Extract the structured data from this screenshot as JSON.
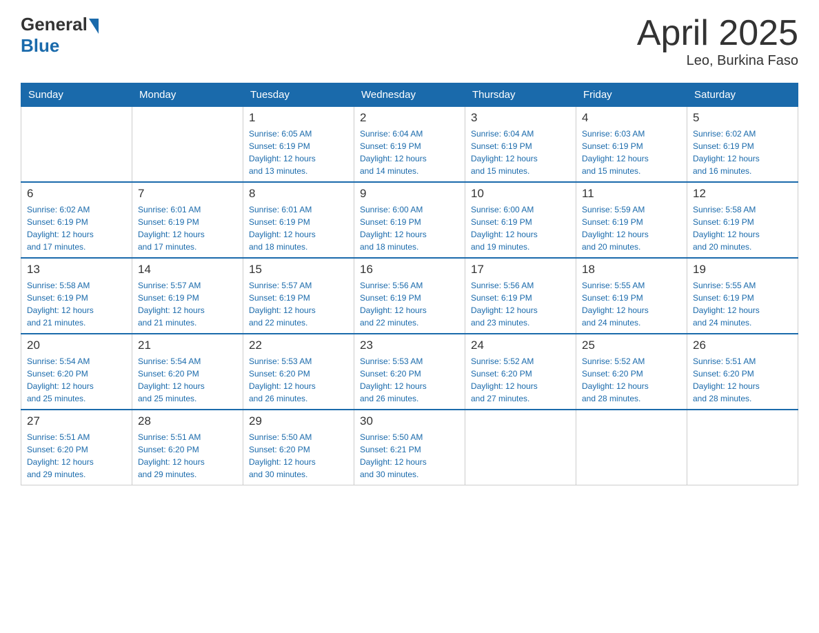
{
  "logo": {
    "text_general": "General",
    "text_blue": "Blue"
  },
  "header": {
    "title": "April 2025",
    "subtitle": "Leo, Burkina Faso"
  },
  "days_of_week": [
    "Sunday",
    "Monday",
    "Tuesday",
    "Wednesday",
    "Thursday",
    "Friday",
    "Saturday"
  ],
  "weeks": [
    [
      {
        "day": "",
        "info": ""
      },
      {
        "day": "",
        "info": ""
      },
      {
        "day": "1",
        "info": "Sunrise: 6:05 AM\nSunset: 6:19 PM\nDaylight: 12 hours\nand 13 minutes."
      },
      {
        "day": "2",
        "info": "Sunrise: 6:04 AM\nSunset: 6:19 PM\nDaylight: 12 hours\nand 14 minutes."
      },
      {
        "day": "3",
        "info": "Sunrise: 6:04 AM\nSunset: 6:19 PM\nDaylight: 12 hours\nand 15 minutes."
      },
      {
        "day": "4",
        "info": "Sunrise: 6:03 AM\nSunset: 6:19 PM\nDaylight: 12 hours\nand 15 minutes."
      },
      {
        "day": "5",
        "info": "Sunrise: 6:02 AM\nSunset: 6:19 PM\nDaylight: 12 hours\nand 16 minutes."
      }
    ],
    [
      {
        "day": "6",
        "info": "Sunrise: 6:02 AM\nSunset: 6:19 PM\nDaylight: 12 hours\nand 17 minutes."
      },
      {
        "day": "7",
        "info": "Sunrise: 6:01 AM\nSunset: 6:19 PM\nDaylight: 12 hours\nand 17 minutes."
      },
      {
        "day": "8",
        "info": "Sunrise: 6:01 AM\nSunset: 6:19 PM\nDaylight: 12 hours\nand 18 minutes."
      },
      {
        "day": "9",
        "info": "Sunrise: 6:00 AM\nSunset: 6:19 PM\nDaylight: 12 hours\nand 18 minutes."
      },
      {
        "day": "10",
        "info": "Sunrise: 6:00 AM\nSunset: 6:19 PM\nDaylight: 12 hours\nand 19 minutes."
      },
      {
        "day": "11",
        "info": "Sunrise: 5:59 AM\nSunset: 6:19 PM\nDaylight: 12 hours\nand 20 minutes."
      },
      {
        "day": "12",
        "info": "Sunrise: 5:58 AM\nSunset: 6:19 PM\nDaylight: 12 hours\nand 20 minutes."
      }
    ],
    [
      {
        "day": "13",
        "info": "Sunrise: 5:58 AM\nSunset: 6:19 PM\nDaylight: 12 hours\nand 21 minutes."
      },
      {
        "day": "14",
        "info": "Sunrise: 5:57 AM\nSunset: 6:19 PM\nDaylight: 12 hours\nand 21 minutes."
      },
      {
        "day": "15",
        "info": "Sunrise: 5:57 AM\nSunset: 6:19 PM\nDaylight: 12 hours\nand 22 minutes."
      },
      {
        "day": "16",
        "info": "Sunrise: 5:56 AM\nSunset: 6:19 PM\nDaylight: 12 hours\nand 22 minutes."
      },
      {
        "day": "17",
        "info": "Sunrise: 5:56 AM\nSunset: 6:19 PM\nDaylight: 12 hours\nand 23 minutes."
      },
      {
        "day": "18",
        "info": "Sunrise: 5:55 AM\nSunset: 6:19 PM\nDaylight: 12 hours\nand 24 minutes."
      },
      {
        "day": "19",
        "info": "Sunrise: 5:55 AM\nSunset: 6:19 PM\nDaylight: 12 hours\nand 24 minutes."
      }
    ],
    [
      {
        "day": "20",
        "info": "Sunrise: 5:54 AM\nSunset: 6:20 PM\nDaylight: 12 hours\nand 25 minutes."
      },
      {
        "day": "21",
        "info": "Sunrise: 5:54 AM\nSunset: 6:20 PM\nDaylight: 12 hours\nand 25 minutes."
      },
      {
        "day": "22",
        "info": "Sunrise: 5:53 AM\nSunset: 6:20 PM\nDaylight: 12 hours\nand 26 minutes."
      },
      {
        "day": "23",
        "info": "Sunrise: 5:53 AM\nSunset: 6:20 PM\nDaylight: 12 hours\nand 26 minutes."
      },
      {
        "day": "24",
        "info": "Sunrise: 5:52 AM\nSunset: 6:20 PM\nDaylight: 12 hours\nand 27 minutes."
      },
      {
        "day": "25",
        "info": "Sunrise: 5:52 AM\nSunset: 6:20 PM\nDaylight: 12 hours\nand 28 minutes."
      },
      {
        "day": "26",
        "info": "Sunrise: 5:51 AM\nSunset: 6:20 PM\nDaylight: 12 hours\nand 28 minutes."
      }
    ],
    [
      {
        "day": "27",
        "info": "Sunrise: 5:51 AM\nSunset: 6:20 PM\nDaylight: 12 hours\nand 29 minutes."
      },
      {
        "day": "28",
        "info": "Sunrise: 5:51 AM\nSunset: 6:20 PM\nDaylight: 12 hours\nand 29 minutes."
      },
      {
        "day": "29",
        "info": "Sunrise: 5:50 AM\nSunset: 6:20 PM\nDaylight: 12 hours\nand 30 minutes."
      },
      {
        "day": "30",
        "info": "Sunrise: 5:50 AM\nSunset: 6:21 PM\nDaylight: 12 hours\nand 30 minutes."
      },
      {
        "day": "",
        "info": ""
      },
      {
        "day": "",
        "info": ""
      },
      {
        "day": "",
        "info": ""
      }
    ]
  ]
}
